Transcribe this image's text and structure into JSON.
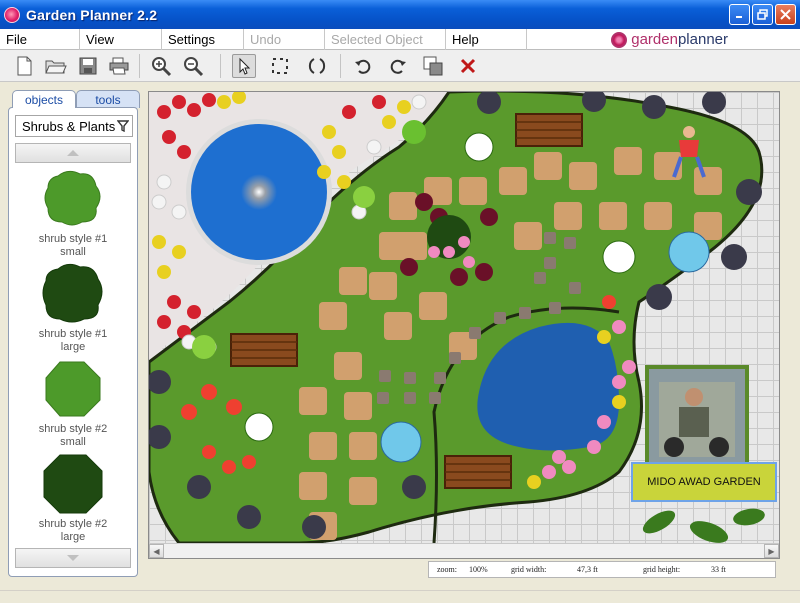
{
  "window": {
    "title": "Garden Planner 2.2"
  },
  "menu": {
    "items": [
      {
        "label": "File",
        "disabled": false
      },
      {
        "label": "View",
        "disabled": false
      },
      {
        "label": "Settings",
        "disabled": false
      },
      {
        "label": "Undo",
        "disabled": true
      },
      {
        "label": "Selected Object",
        "disabled": true
      },
      {
        "label": "Help",
        "disabled": false
      }
    ],
    "brand": {
      "prefix": "garden",
      "suffix": "planner"
    }
  },
  "toolbar": {
    "tools": [
      "new-file",
      "open-folder",
      "save",
      "print",
      "zoom-in",
      "zoom-out",
      "select-pointer",
      "marquee-select",
      "rotate",
      "rotate-left",
      "rotate-right",
      "duplicate",
      "delete"
    ]
  },
  "sidebar": {
    "tabs": [
      "objects",
      "tools"
    ],
    "active_tab": "objects",
    "category": "Shrubs & Plants",
    "items": [
      {
        "label_line1": "shrub style #1",
        "label_line2": "small",
        "color": "#4d9a2a"
      },
      {
        "label_line1": "shrub style #1",
        "label_line2": "large",
        "color": "#1f4a12"
      },
      {
        "label_line1": "shrub style #2",
        "label_line2": "small",
        "color": "#4d9a2a"
      },
      {
        "label_line1": "shrub style #2",
        "label_line2": "large",
        "color": "#1f4a12"
      }
    ]
  },
  "canvas": {
    "sign_text": "MIDO AWAD GARDEN",
    "colors": {
      "lawn": "#5a9a2c",
      "water": "#1f5fb0",
      "paver": "#d1a06e",
      "bench": "#8a4a1e"
    }
  },
  "status": {
    "zoom_label": "zoom:",
    "zoom_value": "100%",
    "width_label": "grid width:",
    "width_value": "47,3 ft",
    "height_label": "grid height:",
    "height_value": "33 ft"
  }
}
